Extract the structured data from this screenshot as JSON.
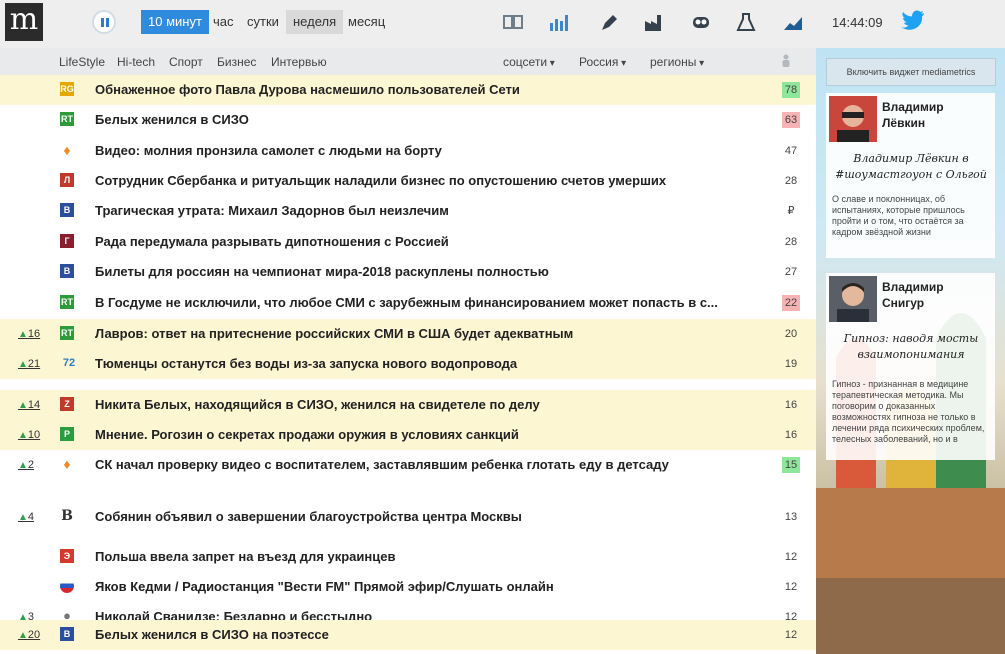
{
  "header": {
    "logo_letter": "m",
    "periods": [
      "10 минут",
      "час",
      "сутки",
      "неделя",
      "месяц"
    ],
    "active_period": "10 минут",
    "selected_period": "неделя",
    "toolbar_icons": [
      "columns-icon",
      "bar-chart-icon",
      "pen-icon",
      "factory-icon",
      "robot-icon",
      "flask-icon",
      "trend-chart-icon",
      "twitter-icon"
    ],
    "clock": "14:44:09"
  },
  "nav": {
    "categories": [
      "LifeStyle",
      "Hi-tech",
      "Спорт",
      "Бизнес",
      "Интервью"
    ],
    "dropdowns": [
      "соцсети",
      "Россия",
      "регионы"
    ]
  },
  "news": [
    {
      "trend": "",
      "source_icon": "rg-icon",
      "title": "Обнаженное фото Павла Дурова насмешило пользователей Сети",
      "count": "78",
      "badge": "green",
      "highlight": true
    },
    {
      "trend": "",
      "source_icon": "rt-icon",
      "title": "Белых женился в СИЗО",
      "count": "63",
      "badge": "red",
      "highlight": false
    },
    {
      "trend": "",
      "source_icon": "flame-icon",
      "title": "Видео: молния пронзила самолет с людьми на борту",
      "count": "47",
      "badge": "",
      "highlight": false
    },
    {
      "trend": "",
      "source_icon": "lenta-icon",
      "title": "Сотрудник Сбербанка и ритуальщик наладили бизнес по опустошению счетов умерших",
      "count": "28",
      "badge": "",
      "highlight": false
    },
    {
      "trend": "",
      "source_icon": "vesti-icon",
      "title": "Трагическая утрата: Михаил Задорнов был неизлечим",
      "count": "₽",
      "badge": "",
      "highlight": false
    },
    {
      "trend": "",
      "source_icon": "gazeta-icon",
      "title": "Рада передумала разрывать дипотношения с Россией",
      "count": "28",
      "badge": "",
      "highlight": false
    },
    {
      "trend": "",
      "source_icon": "vesti-icon",
      "title": "Билеты для россиян на чемпионат мира-2018 раскуплены полностью",
      "count": "27",
      "badge": "",
      "highlight": false
    },
    {
      "trend": "",
      "source_icon": "rt-icon",
      "title": "В Госдуме не исключили, что любое СМИ с зарубежным финансированием может попасть в с...",
      "count": "22",
      "badge": "red",
      "highlight": false
    },
    {
      "trend": "16",
      "source_icon": "rt-icon",
      "title": "Лавров: ответ на притеснение российских СМИ в США будет адекватным",
      "count": "20",
      "badge": "",
      "highlight": true
    },
    {
      "trend": "21",
      "source_icon": "72-icon",
      "title": "Тюменцы останутся без воды из-за запуска нового водопровода",
      "count": "19",
      "badge": "",
      "highlight": true
    },
    {
      "trend": "14",
      "source_icon": "znak-icon",
      "title": "Никита Белых, находящийся в СИЗО, женился на свидетеле по делу",
      "count": "16",
      "badge": "",
      "highlight": true
    },
    {
      "trend": "10",
      "source_icon": "ren-icon",
      "title": "Мнение. Рогозин о секретах продажи оружия в условиях санкций",
      "count": "16",
      "badge": "",
      "highlight": true
    },
    {
      "trend": "2",
      "source_icon": "flame-icon",
      "title": "СК начал проверку видео с воспитателем, заставлявшим ребенка глотать еду в детсаду",
      "count": "15",
      "badge": "green",
      "highlight": false
    },
    {
      "trend": "4",
      "source_icon": "vedomosti-icon",
      "title": "Собянин объявил о завершении благоустройства центра Москвы",
      "count": "13",
      "badge": "",
      "highlight": false
    },
    {
      "trend": "",
      "source_icon": "ekho-icon",
      "title": "Польша ввела запрет на въезд для украинцев",
      "count": "12",
      "badge": "",
      "highlight": false
    },
    {
      "trend": "",
      "source_icon": "flag-icon",
      "title": "Яков Кедми / Радиостанция \"Вести FM\" Прямой эфир/Слушать онлайн",
      "count": "12",
      "badge": "",
      "highlight": false
    },
    {
      "trend": "3",
      "source_icon": "globe-icon",
      "title": "Николай Сванидзе: Бездарно и бесстыдно",
      "count": "12",
      "badge": "",
      "highlight": false
    },
    {
      "trend": "20",
      "source_icon": "vesti-icon",
      "title": "Белых женился в СИЗО на поэтессе",
      "count": "12",
      "badge": "",
      "highlight": true
    }
  ],
  "sidebar": {
    "widget_button": "Включить виджет mediametrics",
    "cards": [
      {
        "author_first": "Владимир",
        "author_last": "Лёвкин",
        "headline": "Владимир Лёвкин в #шоумастгоуон с Ольгой",
        "excerpt": "О славе и поклонницах, об испытаниях, которые пришлось пройти и о том, что остаётся за кадром звёздной жизни"
      },
      {
        "author_first": "Владимир",
        "author_last": "Снигур",
        "headline": "Гипноз: наводя мосты взаимопонимания",
        "excerpt": "Гипноз - признанная в медицине терапевтическая методика. Мы поговорим о доказанных возможностях гипноза не только в лечении ряда психических проблем, телесных заболеваний, но и в"
      }
    ]
  },
  "colors": {
    "accent": "#2f8bde",
    "highlight_row": "#fdf6d3",
    "badge_green": "#8de69a",
    "badge_red": "#f6b3b3",
    "trend_up": "#2aa14c"
  }
}
